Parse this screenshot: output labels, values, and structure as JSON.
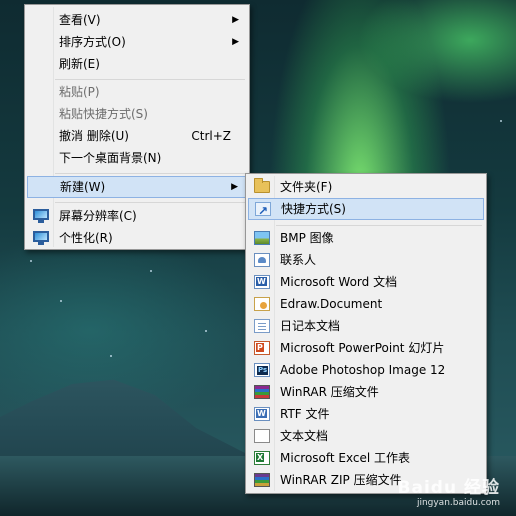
{
  "context_menu": {
    "items": [
      {
        "label": "查看(V)"
      },
      {
        "label": "排序方式(O)"
      },
      {
        "label": "刷新(E)"
      },
      {
        "label": "粘贴(P)"
      },
      {
        "label": "粘贴快捷方式(S)"
      },
      {
        "label": "撤消 删除(U)",
        "shortcut": "Ctrl+Z"
      },
      {
        "label": "下一个桌面背景(N)"
      },
      {
        "label": "新建(W)"
      },
      {
        "label": "屏幕分辨率(C)",
        "icon": "display-settings-icon"
      },
      {
        "label": "个性化(R)",
        "icon": "personalize-icon"
      }
    ]
  },
  "new_submenu": {
    "items": [
      {
        "label": "文件夹(F)",
        "icon": "folder-icon"
      },
      {
        "label": "快捷方式(S)",
        "icon": "shortcut-icon"
      },
      {
        "label": "BMP 图像",
        "icon": "bmp-image-icon"
      },
      {
        "label": "联系人",
        "icon": "contact-icon"
      },
      {
        "label": "Microsoft Word 文档",
        "icon": "word-doc-icon"
      },
      {
        "label": "Edraw.Document",
        "icon": "edraw-doc-icon"
      },
      {
        "label": "日记本文档",
        "icon": "journal-doc-icon"
      },
      {
        "label": "Microsoft PowerPoint 幻灯片",
        "icon": "powerpoint-icon"
      },
      {
        "label": "Adobe Photoshop Image 12",
        "icon": "photoshop-icon"
      },
      {
        "label": "WinRAR 压缩文件",
        "icon": "winrar-icon"
      },
      {
        "label": "RTF 文件",
        "icon": "rtf-doc-icon"
      },
      {
        "label": "文本文档",
        "icon": "text-doc-icon"
      },
      {
        "label": "Microsoft Excel 工作表",
        "icon": "excel-icon"
      },
      {
        "label": "WinRAR ZIP 压缩文件",
        "icon": "winrar-zip-icon"
      }
    ]
  },
  "watermark": {
    "brand": "Baidu 经验",
    "site": "jingyan.baidu.com"
  },
  "colors": {
    "menu_bg": "#f0f0f0",
    "highlight_bg": "#d1e3f6",
    "highlight_border": "#8db2e3",
    "disabled_text": "#6d6d6d"
  }
}
